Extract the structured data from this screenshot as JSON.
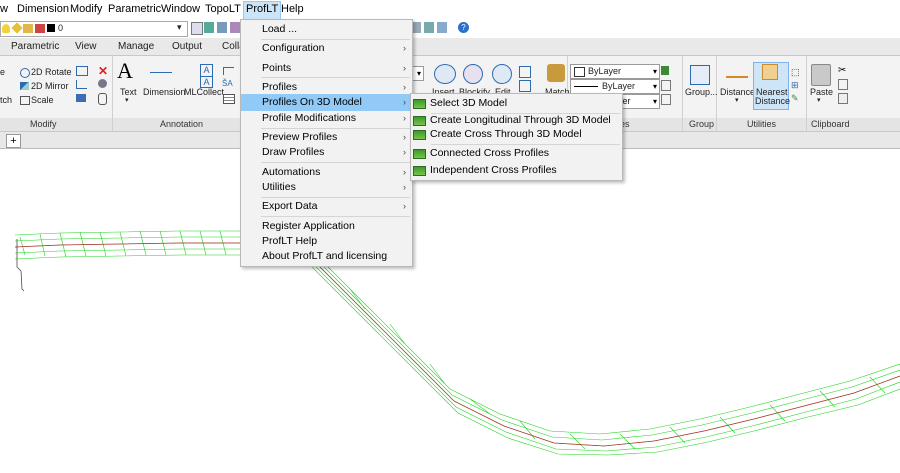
{
  "menubar": {
    "items": [
      "w",
      "Dimension",
      "Modify",
      "Parametric",
      "Window",
      "TopoLT",
      "ProfLT",
      "Help"
    ]
  },
  "qat": {
    "layer_value": "0"
  },
  "ribbon": {
    "tabs": [
      "Parametric",
      "View",
      "Manage",
      "Output",
      "Colla"
    ],
    "panels": [
      "Modify",
      "Annotation",
      "es",
      "Group",
      "Utilities",
      "Clipboard"
    ],
    "modify": {
      "rotate": "2D Rotate",
      "mirror": "2D Mirror",
      "scale": "Scale",
      "stretch": "tch"
    },
    "annotation": {
      "text": "Text",
      "dimension": "Dimension",
      "mlcollect": "MLCollect"
    },
    "block": {
      "insert": "Insert",
      "blockify": "Blockify",
      "edit": "Edit"
    },
    "properties": {
      "match": "Match",
      "bylayer1": "ByLayer",
      "bylayer2": "ByLayer",
      "bylayer3": "yer"
    },
    "group": {
      "label": "Group..."
    },
    "utilities": {
      "distance": "Distance",
      "nearest": "Nearest",
      "nearest2": "Distance"
    },
    "clipboard": {
      "paste": "Paste"
    }
  },
  "filetabs": {
    "plus": "+"
  },
  "menu": {
    "items": [
      {
        "label": "Load ...",
        "arrow": ""
      },
      {
        "label": "Configuration",
        "arrow": "›"
      },
      {
        "label": "Points",
        "arrow": "›"
      },
      {
        "label": "Profiles",
        "arrow": "›"
      },
      {
        "label": "Profiles On 3D Model",
        "arrow": "›"
      },
      {
        "label": "Profile Modifications",
        "arrow": "›"
      },
      {
        "label": "Preview Profiles",
        "arrow": "›"
      },
      {
        "label": "Draw Profiles",
        "arrow": "›"
      },
      {
        "label": "Automations",
        "arrow": "›"
      },
      {
        "label": "Utilities",
        "arrow": "›"
      },
      {
        "label": "Export Data",
        "arrow": "›"
      },
      {
        "label": "Register Application",
        "arrow": ""
      },
      {
        "label": "ProfLT Help",
        "arrow": ""
      },
      {
        "label": "About ProfLT and licensing",
        "arrow": ""
      }
    ]
  },
  "submenu": {
    "items": [
      "Select 3D Model",
      "Create Longitudinal Through 3D Model",
      "Create Cross Through 3D Model",
      "Connected Cross Profiles",
      "Independent Cross Profiles"
    ]
  },
  "colors": {
    "highlight": "#91c9f7",
    "mesh": "#1ed61e",
    "menu_bg": "#f2f2f2"
  }
}
